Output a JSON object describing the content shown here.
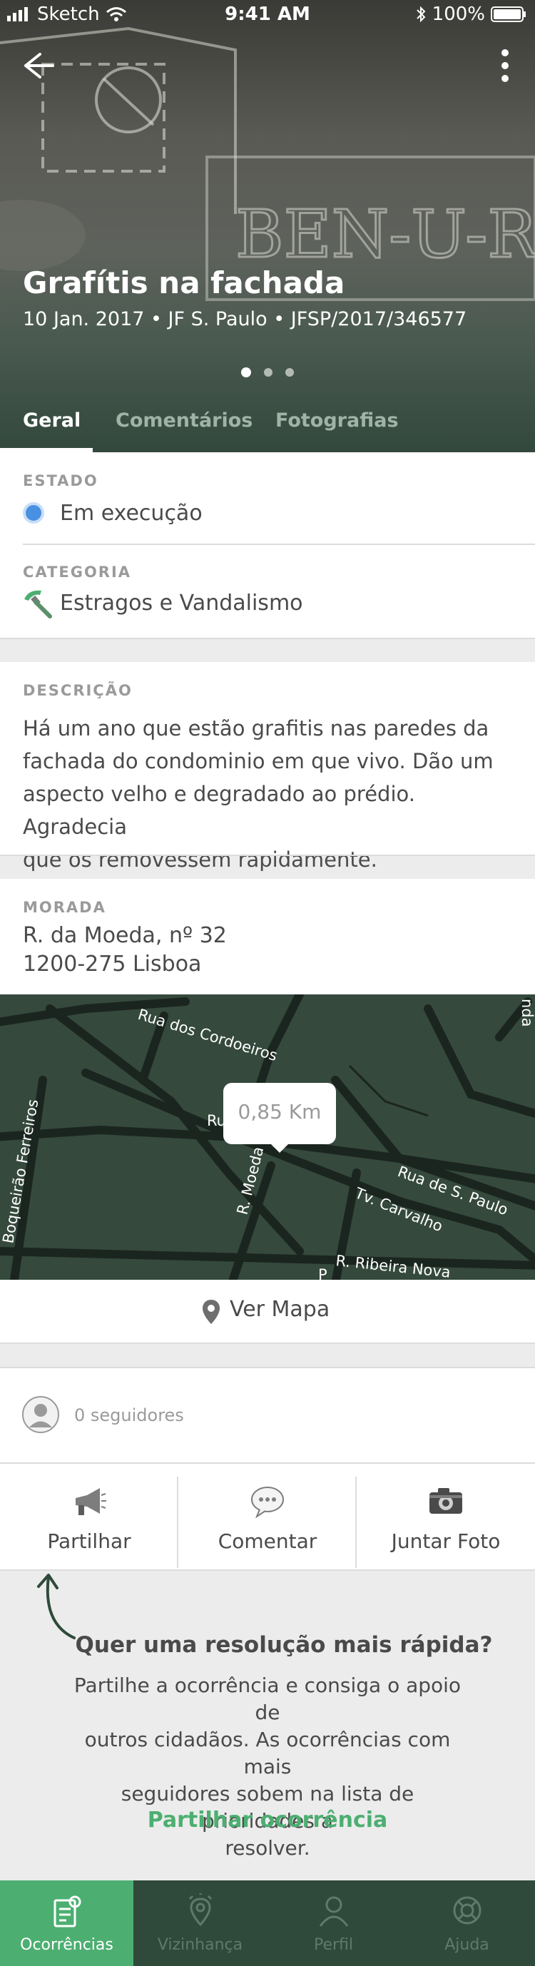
{
  "status_bar": {
    "carrier": "Sketch",
    "time": "9:41 AM",
    "battery": "100%"
  },
  "header": {
    "title": "Grafítis na fachada",
    "subtitle": "10 Jan. 2017 • JF S. Paulo • JFSP/2017/346577",
    "graffiti_text": "BEN-U-RON",
    "photo_count": 3,
    "active_photo": 1
  },
  "tabs": [
    {
      "label": "Geral",
      "active": true
    },
    {
      "label": "Comentários",
      "active": false
    },
    {
      "label": "Fotografias",
      "active": false
    }
  ],
  "estado": {
    "label": "ESTADO",
    "value": "Em execução",
    "color": "#4a90e2"
  },
  "categoria": {
    "label": "CATEGORIA",
    "value": "Estragos e Vandalismo",
    "icon": "hammer-icon"
  },
  "descricao": {
    "label": "DESCRIÇÃO",
    "lines": [
      "Há um ano que estão grafitis nas paredes da",
      "fachada do condominio em que vivo. Dão um",
      "aspecto velho e degradado ao prédio. Agradecia",
      "que os removessem rapidamente."
    ]
  },
  "morada": {
    "label": "MORADA",
    "line1": "R. da Moeda, nº 32",
    "line2": "1200-275 Lisboa"
  },
  "map": {
    "distance": "0,85 Km",
    "streets": {
      "cordoeiros": "Rua dos Cordoeiros",
      "boqueirao": "Boqueirão Ferreiros",
      "moeda": "R. Moeda",
      "rua_partial": "Ru",
      "s_paulo": "Rua de S. Paulo",
      "carvalho": "Tv. Carvalho",
      "ribeira": "R. Ribeira Nova",
      "edge": "nda",
      "p_partial": "P"
    },
    "ver_mapa": "Ver Mapa"
  },
  "followers": {
    "text": "0 seguidores"
  },
  "actions": [
    {
      "label": "Partilhar",
      "icon": "megaphone-icon"
    },
    {
      "label": "Comentar",
      "icon": "speech-bubble-icon"
    },
    {
      "label": "Juntar Foto",
      "icon": "camera-icon"
    }
  ],
  "promo": {
    "title": "Quer uma resolução mais rápida?",
    "lines": [
      "Partilhe a ocorrência e consiga o apoio de",
      "outros cidadãos. As ocorrências com mais",
      "seguidores sobem na lista de prioridades a",
      "resolver."
    ],
    "link": "Partilhar ocorrência"
  },
  "tabbar": [
    {
      "label": "Ocorrências",
      "icon": "report-icon",
      "active": true
    },
    {
      "label": "Vizinhança",
      "icon": "location-pin-icon",
      "active": false
    },
    {
      "label": "Perfil",
      "icon": "user-icon",
      "active": false
    },
    {
      "label": "Ajuda",
      "icon": "lifebuoy-icon",
      "active": false
    }
  ],
  "colors": {
    "brand_green": "#4caf71",
    "dark_green": "#2f4a3a",
    "status_blue": "#4a90e2"
  }
}
